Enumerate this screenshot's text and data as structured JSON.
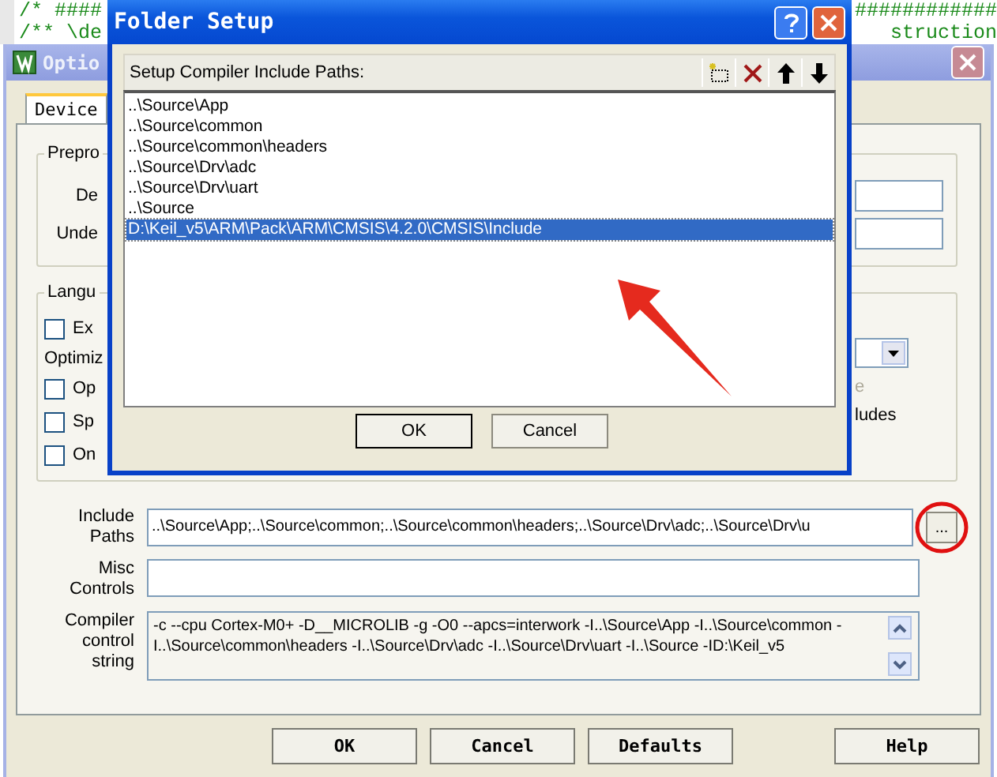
{
  "editor": {
    "lines": [
      {
        "left": "/* ####",
        "right": "############"
      },
      {
        "left": "/** \\de",
        "right": "struction"
      }
    ]
  },
  "options_dialog": {
    "title": "Optio",
    "tabs": [
      {
        "label": "Device",
        "selected": true
      }
    ],
    "preprocessor": {
      "title": "Prepro",
      "labels": [
        "De",
        "Unde"
      ]
    },
    "language": {
      "title": "Langu",
      "rows": [
        {
          "kind": "checkbox",
          "label": "Ex",
          "checked": false
        },
        {
          "kind": "label",
          "label": "Optimiz"
        },
        {
          "kind": "checkbox",
          "label": "Op",
          "checked": false
        },
        {
          "kind": "checkbox",
          "label": "Sp",
          "checked": false
        },
        {
          "kind": "checkbox",
          "label": "On",
          "checked": false
        }
      ],
      "right_texts": [
        {
          "text": "e",
          "disabled": true
        },
        {
          "text": "ludes",
          "disabled": false
        }
      ]
    },
    "include_paths": {
      "label": "Include\nPaths",
      "value": "..\\Source\\App;..\\Source\\common;..\\Source\\common\\headers;..\\Source\\Drv\\adc;..\\Source\\Drv\\u",
      "browse": "..."
    },
    "misc_controls": {
      "label": "Misc\nControls"
    },
    "compiler_string": {
      "label": "Compiler\ncontrol\nstring",
      "value": "-c --cpu Cortex-M0+ -D__MICROLIB -g -O0 --apcs=interwork -I..\\Source\\App -I..\\Source\\common -I..\\Source\\common\\headers -I..\\Source\\Drv\\adc -I..\\Source\\Drv\\uart -I..\\Source -ID:\\Keil_v5"
    },
    "buttons": [
      "OK",
      "Cancel",
      "Defaults",
      "Help"
    ]
  },
  "folder_setup": {
    "title": "Folder Setup",
    "heading": "Setup Compiler Include Paths:",
    "paths": [
      {
        "text": "..\\Source\\App",
        "selected": false
      },
      {
        "text": "..\\Source\\common",
        "selected": false
      },
      {
        "text": "..\\Source\\common\\headers",
        "selected": false
      },
      {
        "text": "..\\Source\\Drv\\adc",
        "selected": false
      },
      {
        "text": "..\\Source\\Drv\\uart",
        "selected": false
      },
      {
        "text": "..\\Source",
        "selected": false
      },
      {
        "text": "D:\\Keil_v5\\ARM\\Pack\\ARM\\CMSIS\\4.2.0\\CMSIS\\Include",
        "selected": true
      }
    ],
    "buttons": [
      "OK",
      "Cancel"
    ]
  }
}
